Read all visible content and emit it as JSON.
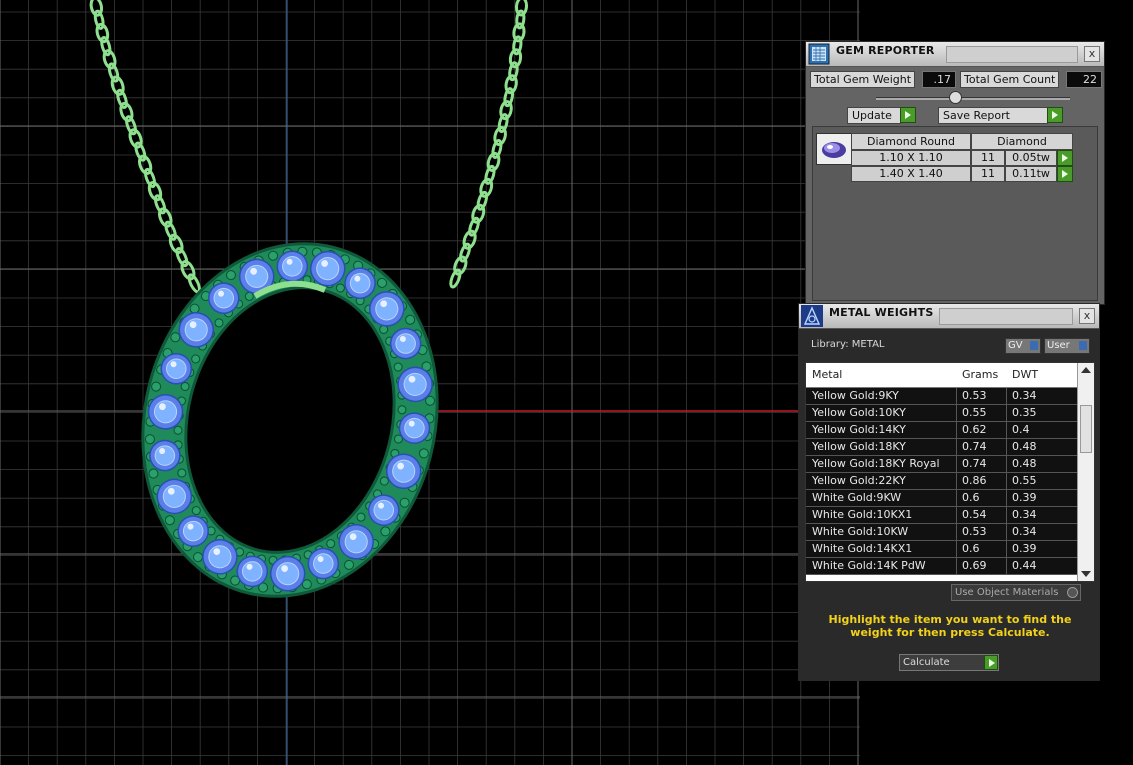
{
  "gem_reporter": {
    "title": "GEM REPORTER",
    "close": "x",
    "total_weight_label": "Total Gem Weight",
    "total_weight_value": ".17",
    "total_count_label": "Total Gem Count",
    "total_count_value": "22",
    "update_label": "Update",
    "save_label": "Save Report",
    "header_shape": "Diamond Round",
    "header_material": "Diamond",
    "gems": [
      {
        "size": "1.10 X 1.10",
        "count": "11",
        "weight": "0.05tw"
      },
      {
        "size": "1.40 X 1.40",
        "count": "11",
        "weight": "0.11tw"
      }
    ]
  },
  "metal_weights": {
    "title": "METAL WEIGHTS",
    "close": "x",
    "library_label": "Library: METAL",
    "gv_label": "GV",
    "user_label": "User",
    "columns": [
      "Metal",
      "Grams",
      "DWT"
    ],
    "rows": [
      {
        "metal": "Yellow Gold:9KY",
        "grams": "0.53",
        "dwt": "0.34"
      },
      {
        "metal": "Yellow Gold:10KY",
        "grams": "0.55",
        "dwt": "0.35"
      },
      {
        "metal": "Yellow Gold:14KY",
        "grams": "0.62",
        "dwt": "0.4"
      },
      {
        "metal": "Yellow Gold:18KY",
        "grams": "0.74",
        "dwt": "0.48"
      },
      {
        "metal": "Yellow Gold:18KY Royal",
        "grams": "0.74",
        "dwt": "0.48"
      },
      {
        "metal": "Yellow Gold:22KY",
        "grams": "0.86",
        "dwt": "0.55"
      },
      {
        "metal": "White Gold:9KW",
        "grams": "0.6",
        "dwt": "0.39"
      },
      {
        "metal": "White Gold:10KX1",
        "grams": "0.54",
        "dwt": "0.34"
      },
      {
        "metal": "White Gold:10KW",
        "grams": "0.53",
        "dwt": "0.34"
      },
      {
        "metal": "White Gold:14KX1",
        "grams": "0.6",
        "dwt": "0.39"
      },
      {
        "metal": "White Gold:14K PdW",
        "grams": "0.69",
        "dwt": "0.44"
      }
    ],
    "use_object_materials": "Use Object Materials",
    "message": "Highlight the item you want to find the weight for then press Calculate.",
    "calculate_label": "Calculate"
  },
  "colors": {
    "chain": "#8ee08e",
    "setting": "#1f8a5a",
    "gem": "#7fb2ff",
    "axis_x": "#c21a2a",
    "axis_y": "#3a6fa8",
    "message": "#f2d21a"
  }
}
